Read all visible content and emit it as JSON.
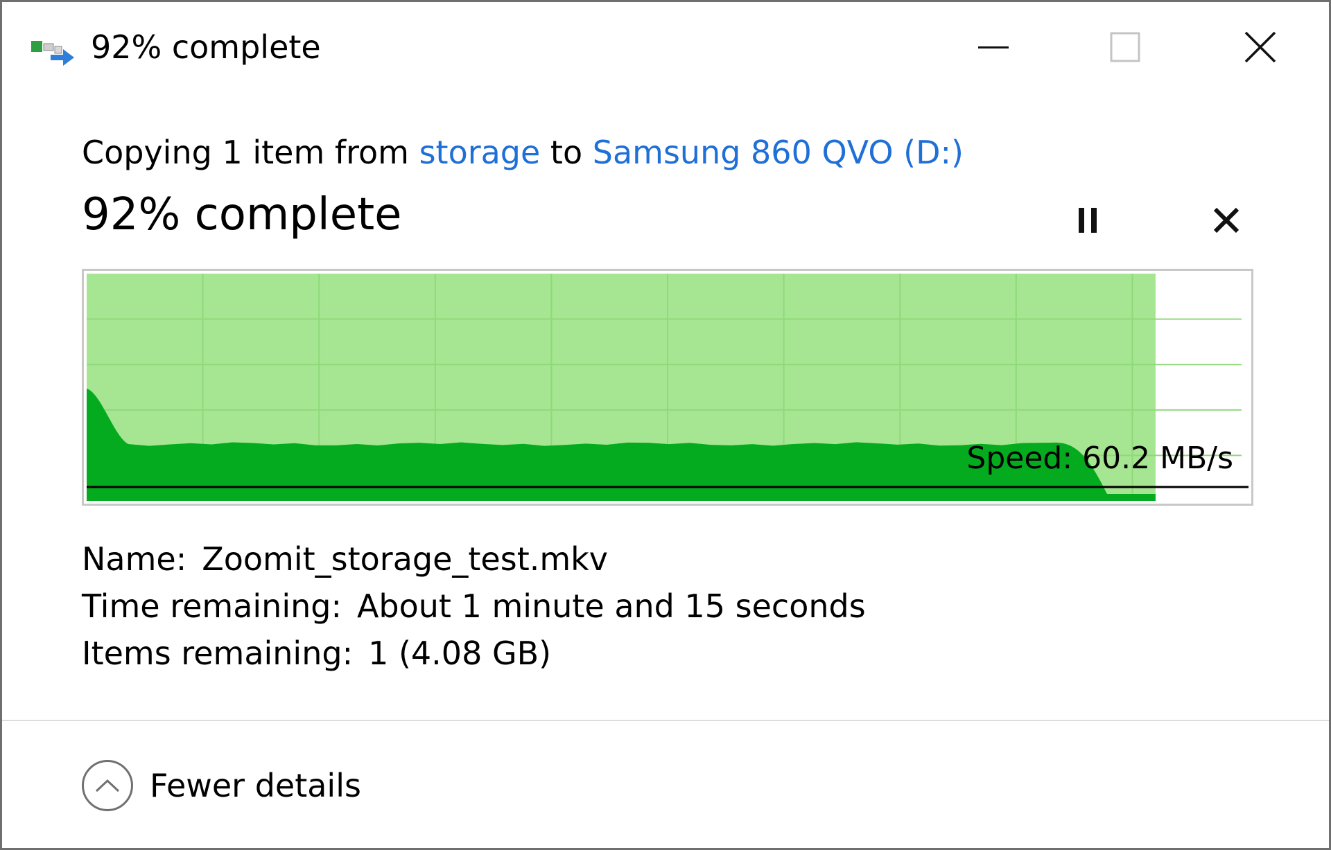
{
  "window": {
    "title": "92% complete",
    "icon": "copy-files-icon"
  },
  "copy": {
    "prefix": "Copying 1 item from ",
    "source": "storage",
    "middle": " to ",
    "destination": "Samsung 860 QVO (D:)"
  },
  "progress": {
    "label": "92% complete",
    "percent": 92
  },
  "graph": {
    "speed_label": "Speed: 60.2 MB/s",
    "fill_color": "#a6e591",
    "line_color": "#05ab1f"
  },
  "details": {
    "name_label": "Name:",
    "name_value": "Zoomit_storage_test.mkv",
    "time_label": "Time remaining:",
    "time_value": "About 1 minute and 15 seconds",
    "items_label": "Items remaining:",
    "items_value": "1 (4.08 GB)"
  },
  "footer": {
    "toggle_label": "Fewer details"
  },
  "colors": {
    "link": "#1e6fd6"
  }
}
